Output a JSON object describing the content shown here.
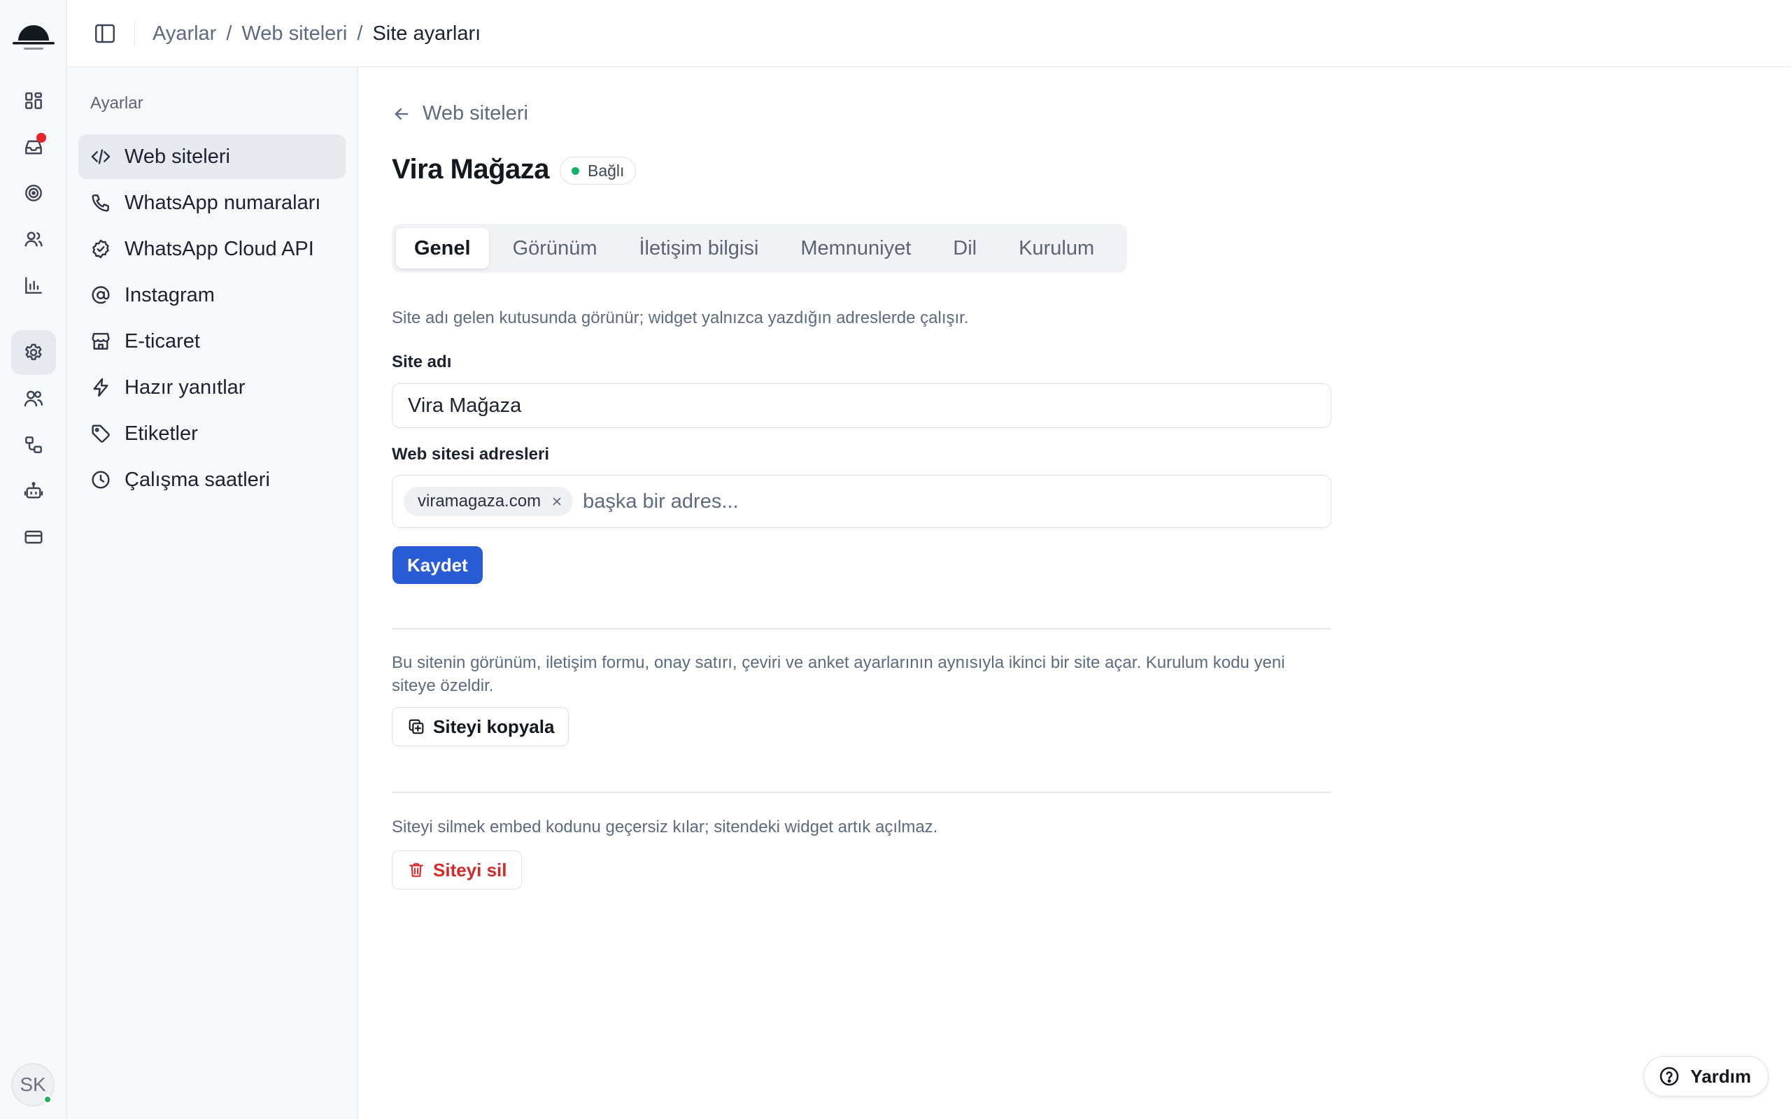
{
  "app": {
    "colors": {
      "primary": "#2a5bd7",
      "danger": "#d42a2a",
      "status_connected": "#10b06b",
      "notification": "#e5252a"
    }
  },
  "rail": {
    "items": [
      {
        "icon": "dashboard-icon"
      },
      {
        "icon": "inbox-icon",
        "has_notification": true
      },
      {
        "icon": "target-icon"
      },
      {
        "icon": "contacts-icon"
      },
      {
        "icon": "bar-chart-icon"
      },
      {
        "icon": "gear-icon",
        "active": true
      },
      {
        "icon": "team-icon"
      },
      {
        "icon": "workflow-icon"
      },
      {
        "icon": "bot-icon"
      },
      {
        "icon": "credit-card-icon"
      }
    ],
    "avatar_initials": "SK"
  },
  "header": {
    "breadcrumb": [
      "Ayarlar",
      "Web siteleri",
      "Site ayarları"
    ]
  },
  "subnav": {
    "title": "Ayarlar",
    "items": [
      {
        "label": "Web siteleri",
        "icon": "code-icon",
        "active": true
      },
      {
        "label": "WhatsApp numaraları",
        "icon": "phone-icon"
      },
      {
        "label": "WhatsApp Cloud API",
        "icon": "verified-badge-icon"
      },
      {
        "label": "Instagram",
        "icon": "at-sign-icon"
      },
      {
        "label": "E-ticaret",
        "icon": "store-icon"
      },
      {
        "label": "Hazır yanıtlar",
        "icon": "lightning-icon"
      },
      {
        "label": "Etiketler",
        "icon": "tag-icon"
      },
      {
        "label": "Çalışma saatleri",
        "icon": "clock-icon"
      }
    ]
  },
  "main": {
    "back_label": "Web siteleri",
    "title": "Vira Mağaza",
    "status": "Bağlı",
    "tabs": [
      "Genel",
      "Görünüm",
      "İletişim bilgisi",
      "Memnuniyet",
      "Dil",
      "Kurulum"
    ],
    "active_tab": "Genel",
    "intro": "Site adı gelen kutusunda görünür; widget yalnızca yazdığın adreslerde çalışır.",
    "site_name_label": "Site adı",
    "site_name_value": "Vira Mağaza",
    "addresses_label": "Web sitesi adresleri",
    "addresses": [
      "viramagaza.com"
    ],
    "address_placeholder": "başka bir adres...",
    "save_label": "Kaydet",
    "copy_desc": "Bu sitenin görünüm, iletişim formu, onay satırı, çeviri ve anket ayarlarının aynısıyla ikinci bir site açar. Kurulum kodu yeni siteye özeldir.",
    "copy_label": "Siteyi kopyala",
    "delete_desc": "Siteyi silmek embed kodunu geçersiz kılar; sitendeki widget artık açılmaz.",
    "delete_label": "Siteyi sil"
  },
  "help_label": "Yardım"
}
